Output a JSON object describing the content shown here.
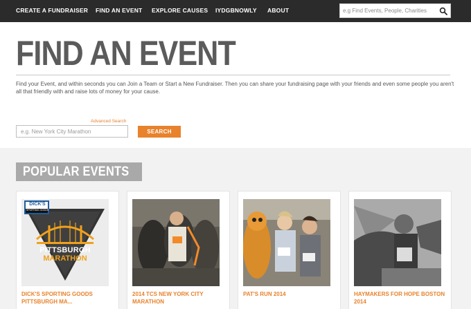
{
  "nav": {
    "items": [
      "CREATE A FUNDRAISER",
      "FIND AN EVENT",
      "EXPLORE CAUSES",
      "IYDGBNOWLY",
      "ABOUT"
    ],
    "search_placeholder": "e.g Find Events, People, Charities"
  },
  "header": {
    "title": "FIND AN EVENT",
    "intro": "Find your Event, and within seconds you can Join a Team or Start a New Fundraiser. Then you can share your fundraising page with your friends and even some people you aren't all that friendly with and raise lots of money for your cause."
  },
  "search": {
    "advanced_link": "Advanced Search",
    "placeholder": "e.g. New York City Marathon",
    "button": "SEARCH"
  },
  "popular": {
    "heading": "POPULAR EVENTS",
    "cards": [
      {
        "title": "DICK'S SPORTING GOODS PITTSBURGH MA...",
        "logo_top": "DICK'S",
        "logo_sub": "SPORTING GOODS",
        "logo_line1": "PITTSBURGH",
        "logo_line2": "MARATHON"
      },
      {
        "title": "2014 TCS NEW YORK CITY MARATHON"
      },
      {
        "title": "PAT'S RUN 2014"
      },
      {
        "title": "HAYMAKERS FOR HOPE BOSTON 2014"
      }
    ]
  },
  "colors": {
    "accent": "#e8822c",
    "nav_bg": "#2b2b2b",
    "title_gray": "#5b5b5b",
    "label_gray": "#a9a9a9"
  }
}
